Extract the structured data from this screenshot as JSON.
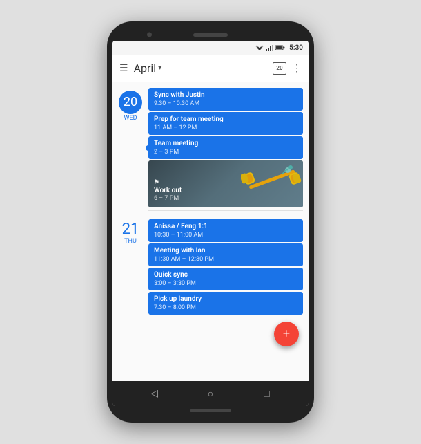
{
  "status_bar": {
    "time": "5:30"
  },
  "header": {
    "menu_label": "☰",
    "title": "April",
    "dropdown_arrow": "▾",
    "calendar_day": "20",
    "more_icon": "⋮"
  },
  "days": [
    {
      "number": "20",
      "name": "Wed",
      "is_today": true,
      "events": [
        {
          "title": "Sync with Justin",
          "time": "9:30 – 10:30 AM",
          "type": "regular"
        },
        {
          "title": "Prep for team meeting",
          "time": "11 AM – 12 PM",
          "type": "regular"
        },
        {
          "title": "Team meeting",
          "time": "2 – 3 PM",
          "type": "regular"
        },
        {
          "title": "Work out",
          "time": "6 – 7 PM",
          "type": "workout"
        }
      ]
    },
    {
      "number": "21",
      "name": "Thu",
      "is_today": false,
      "events": [
        {
          "title": "Anissa / Feng 1:1",
          "time": "10:30 – 11:00 AM",
          "type": "regular"
        },
        {
          "title": "Meeting with Ian",
          "time": "11:30 AM – 12:30 PM",
          "type": "regular"
        },
        {
          "title": "Quick sync",
          "time": "3:00 – 3:30 PM",
          "type": "regular"
        },
        {
          "title": "Pick up laundry",
          "time": "7:30 – 8:00 PM",
          "type": "regular"
        }
      ]
    }
  ],
  "nav": {
    "back": "◁",
    "home": "○",
    "recent": "□"
  },
  "fab": {
    "label": "+"
  }
}
